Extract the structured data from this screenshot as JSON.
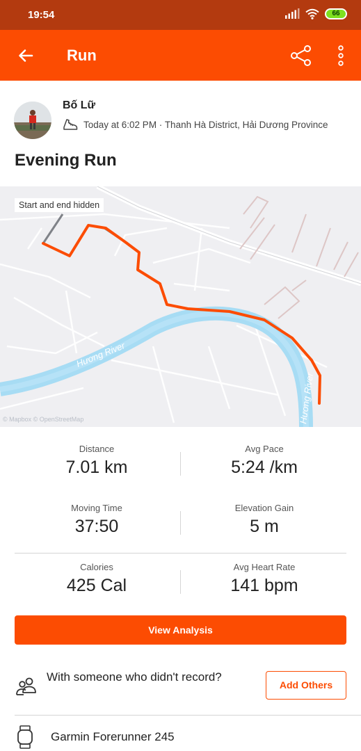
{
  "status_bar": {
    "time": "19:54",
    "signal_icon": "signal-icon",
    "wifi_icon": "wifi-icon",
    "battery_level": "66",
    "battery_color": "#7ee020"
  },
  "app_bar": {
    "title": "Run",
    "background": "#fc4c02",
    "back_icon": "back-arrow-icon",
    "share_icon": "share-icon",
    "more_icon": "more-vertical-icon"
  },
  "athlete": {
    "name": "Bố Lữ",
    "activity_icon": "shoe-icon",
    "meta": "Today at 6:02 PM · Thanh Hà District, Hải Dương Province"
  },
  "activity": {
    "title": "Evening Run"
  },
  "map": {
    "hidden_note": "Start and end hidden",
    "river_label": "Hương River",
    "attribution": "© Mapbox © OpenStreetMap",
    "route_color": "#fc4c02",
    "river_color": "#a7dcf4"
  },
  "stats": {
    "distance": {
      "label": "Distance",
      "value": "7.01 km"
    },
    "avg_pace": {
      "label": "Avg Pace",
      "value": "5:24 /km"
    },
    "moving_time": {
      "label": "Moving Time",
      "value": "37:50"
    },
    "elevation_gain": {
      "label": "Elevation Gain",
      "value": "5 m"
    },
    "calories": {
      "label": "Calories",
      "value": "425 Cal"
    },
    "avg_heart_rate": {
      "label": "Avg Heart Rate",
      "value": "141 bpm"
    }
  },
  "actions": {
    "view_analysis": "View Analysis",
    "with_someone": "With someone who didn't record?",
    "add_others": "Add Others",
    "people_icon": "people-icon"
  },
  "device": {
    "name": "Garmin Forerunner 245",
    "icon": "watch-icon"
  }
}
